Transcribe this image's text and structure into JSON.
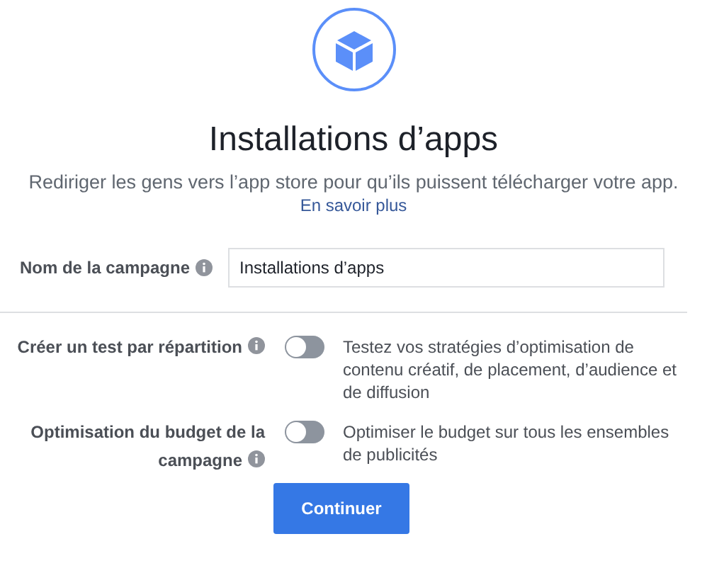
{
  "header": {
    "title": "Installations d’apps",
    "description": "Rediriger les gens vers l’app store pour qu’ils puissent télécharger votre app.",
    "link": "En savoir plus"
  },
  "campaign_name": {
    "label": "Nom de la campagne",
    "value": "Installations d’apps"
  },
  "options": [
    {
      "label": "Créer un test par répartition",
      "on": false,
      "description": "Testez vos stratégies d’optimisation de contenu créatif, de placement, d’audience et de diffusion"
    },
    {
      "label": "Optimisation du budget de la campagne",
      "on": false,
      "description": "Optimiser le budget sur tous les ensembles de publicités"
    }
  ],
  "primary_button": "Continuer"
}
